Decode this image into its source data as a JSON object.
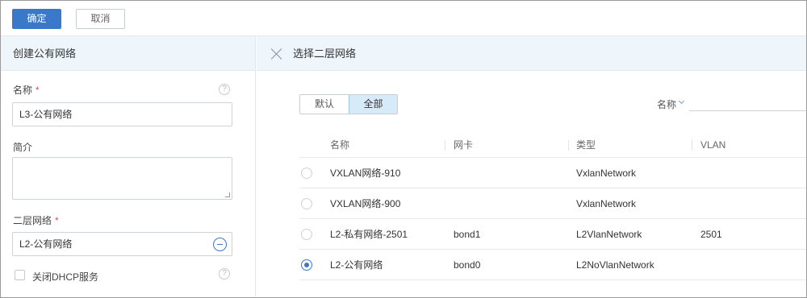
{
  "toolbar": {
    "confirm_label": "确定",
    "cancel_label": "取消"
  },
  "left_panel": {
    "title": "创建公有网络",
    "name_label": "名称",
    "name_required": "*",
    "name_value": "L3-公有网络",
    "desc_label": "简介",
    "l2_label": "二层网络",
    "l2_required": "*",
    "l2_value": "L2-公有网络",
    "dhcp_label": "关闭DHCP服务",
    "dhcp_checked": false
  },
  "right_panel": {
    "title": "选择二层网络",
    "tabs": [
      {
        "label": "默认",
        "active": false
      },
      {
        "label": "全部",
        "active": true
      }
    ],
    "filter_label": "名称",
    "columns": {
      "name": "名称",
      "nic": "网卡",
      "type": "类型",
      "vlan": "VLAN"
    },
    "rows": [
      {
        "selected": false,
        "name": "VXLAN网络-910",
        "nic": "",
        "type": "VxlanNetwork",
        "vlan": ""
      },
      {
        "selected": false,
        "name": "VXLAN网络-900",
        "nic": "",
        "type": "VxlanNetwork",
        "vlan": ""
      },
      {
        "selected": false,
        "name": "L2-私有网络-2501",
        "nic": "bond1",
        "type": "L2VlanNetwork",
        "vlan": "2501"
      },
      {
        "selected": true,
        "name": "L2-公有网络",
        "nic": "bond0",
        "type": "L2NoVlanNetwork",
        "vlan": ""
      }
    ]
  },
  "icons": {
    "help": "help-circle-icon",
    "remove": "minus-circle-icon",
    "close": "close-icon",
    "filter_toggle": "chevron-down-icon"
  },
  "colors": {
    "primary": "#3a78c9",
    "header_bg": "#eef5fb",
    "tab_active_bg": "#d6eaf8"
  }
}
